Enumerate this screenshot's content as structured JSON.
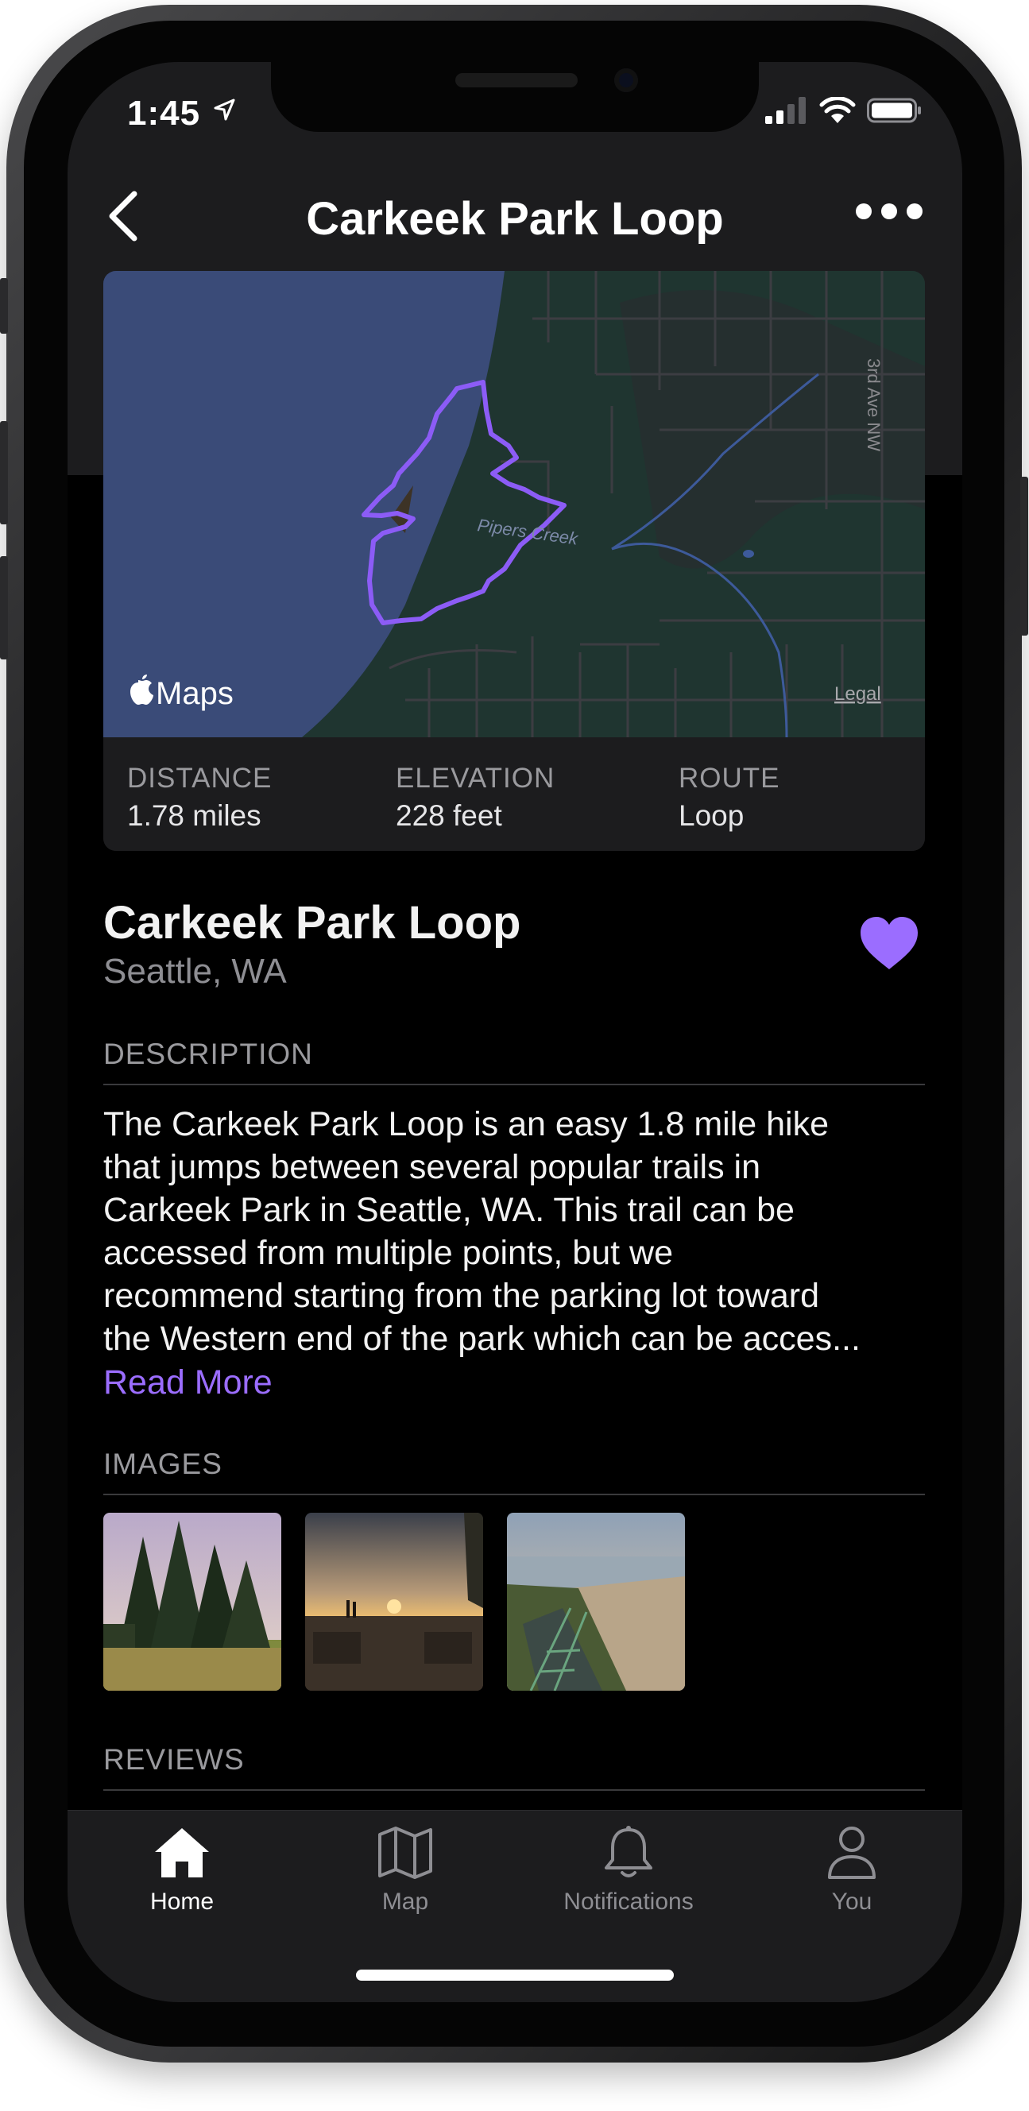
{
  "status_bar": {
    "time": "1:45"
  },
  "nav": {
    "title": "Carkeek Park Loop"
  },
  "map": {
    "brand": "Maps",
    "legal": "Legal",
    "street_label": "3rd Ave NW",
    "creek_label": "Pipers Creek"
  },
  "stats": [
    {
      "label": "DISTANCE",
      "value": "1.78 miles"
    },
    {
      "label": "ELEVATION",
      "value": "228 feet"
    },
    {
      "label": "ROUTE",
      "value": "Loop"
    }
  ],
  "trail": {
    "name": "Carkeek Park Loop",
    "location": "Seattle, WA",
    "favorited": true
  },
  "sections": {
    "description": "DESCRIPTION",
    "images": "IMAGES",
    "reviews": "REVIEWS"
  },
  "description": {
    "lines": [
      "The Carkeek Park Loop is an easy 1.8 mile hike",
      "that jumps between several popular trails in",
      "Carkeek Park in Seattle, WA. This trail can be",
      "accessed from multiple points, but we",
      "recommend starting from the parking lot toward",
      "the Western end of the park which can be acces..."
    ],
    "read_more": "Read More"
  },
  "tabs": [
    {
      "label": "Home",
      "icon": "house-icon",
      "active": true
    },
    {
      "label": "Map",
      "icon": "map-icon",
      "active": false
    },
    {
      "label": "Notifications",
      "icon": "bell-icon",
      "active": false
    },
    {
      "label": "You",
      "icon": "person-icon",
      "active": false
    }
  ],
  "colors": {
    "accent": "#9b6dff",
    "water": "#3a4b78",
    "background": "#000000"
  }
}
